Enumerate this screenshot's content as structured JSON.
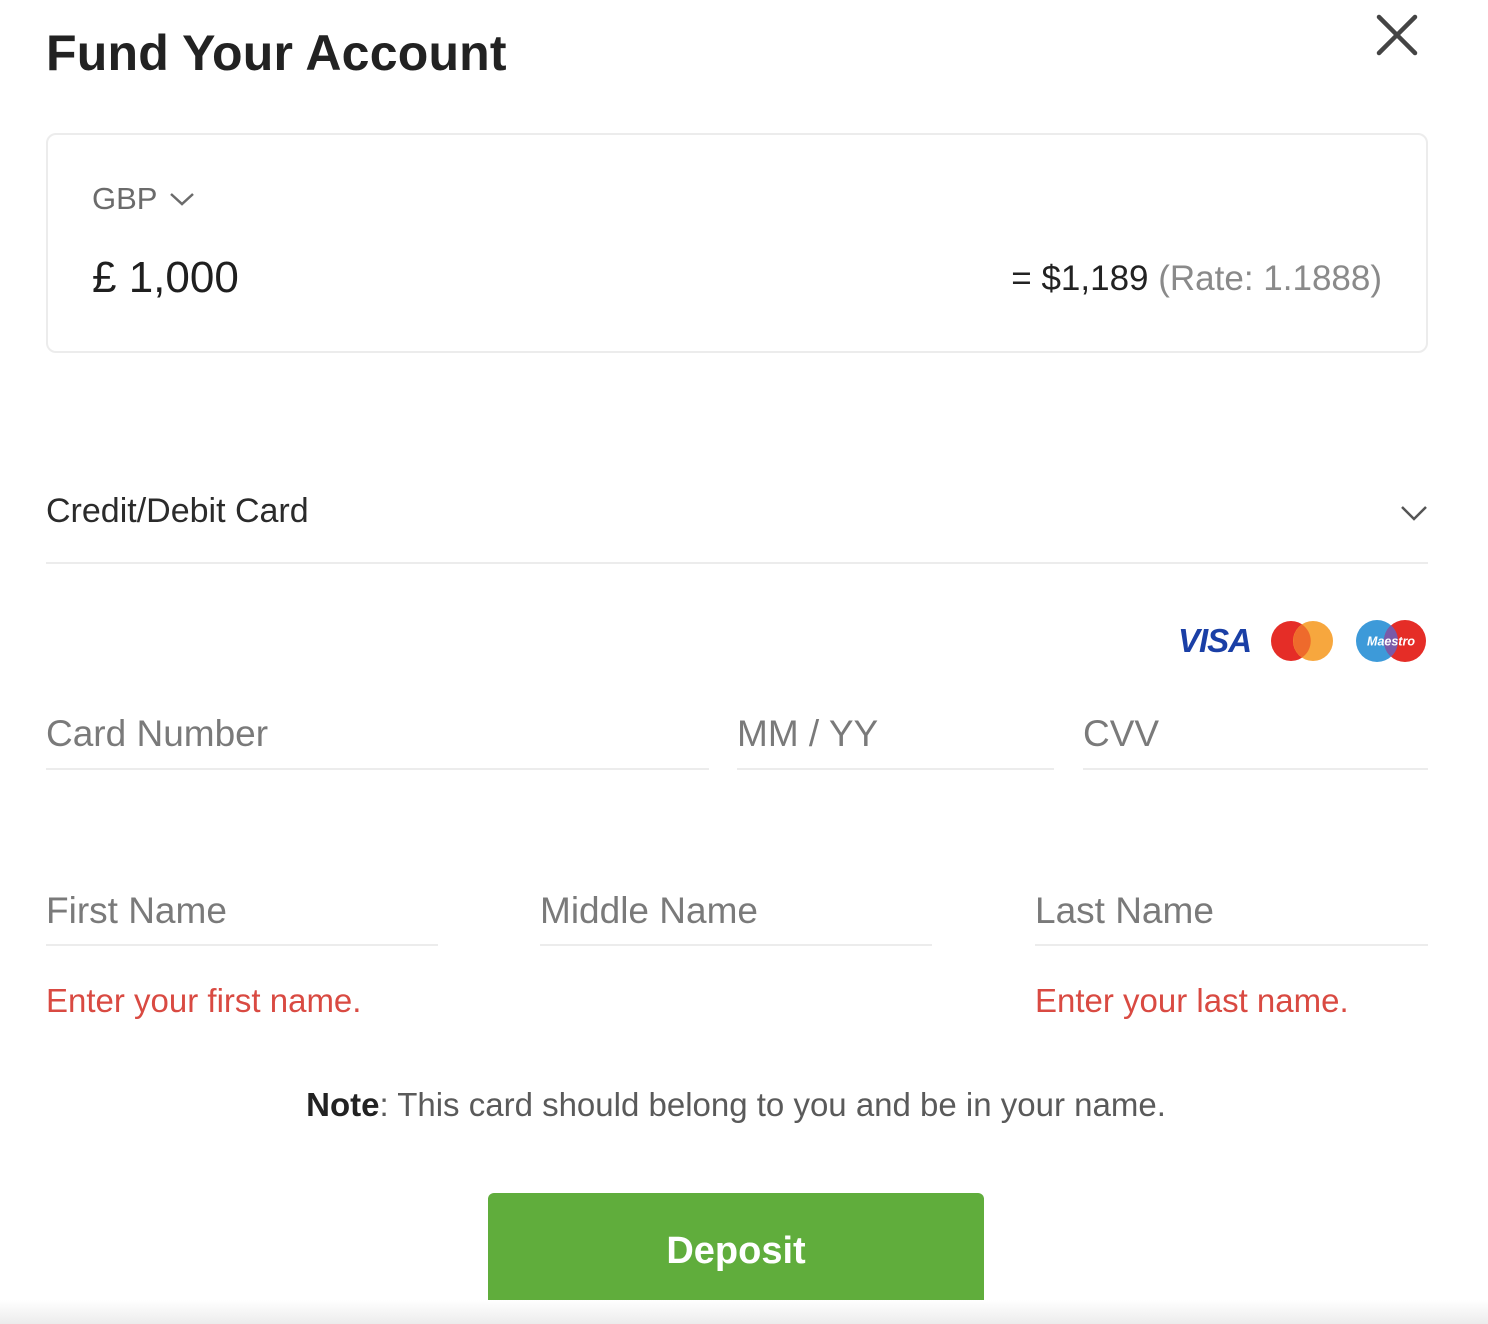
{
  "dialog": {
    "title": "Fund Your Account",
    "close_icon": "close-icon"
  },
  "amount": {
    "currency": "GBP",
    "value": "£ 1,000",
    "converted": "= $1,189",
    "rate": "(Rate: 1.1888)"
  },
  "payment_method": {
    "label": "Credit/Debit Card",
    "icon": "chevron-down-icon"
  },
  "card_brands": {
    "visa": "VISA",
    "mastercard_icon": "mastercard-logo-icon",
    "maestro": "Maestro",
    "colors": {
      "visa": "#1a3fa6",
      "red": "#e52d27",
      "orange": "#f7a234",
      "blue": "#3d9ad9"
    }
  },
  "form": {
    "card_number_placeholder": "Card Number",
    "expiry_placeholder": "MM / YY",
    "cvv_placeholder": "CVV",
    "first_name_placeholder": "First Name",
    "middle_name_placeholder": "Middle Name",
    "last_name_placeholder": "Last Name",
    "first_name_error": "Enter your first name.",
    "last_name_error": "Enter your last name."
  },
  "note": {
    "label": "Note",
    "text": ": This card should belong to you and be in your name."
  },
  "deposit_button": {
    "label": "Deposit",
    "color": "#60ad3c"
  }
}
